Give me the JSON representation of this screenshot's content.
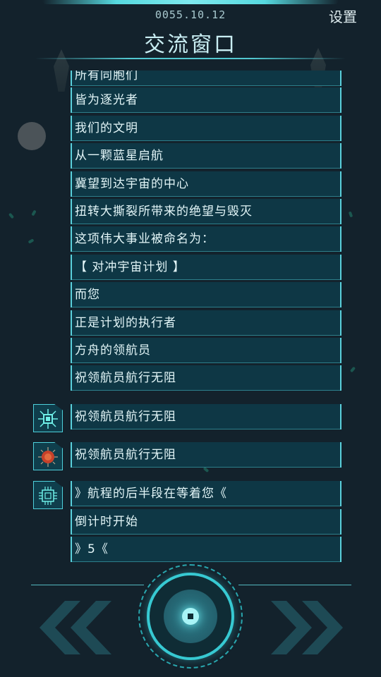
{
  "header": {
    "date": "0055.10.12",
    "settings_label": "设置",
    "title": "交流窗口"
  },
  "messages": [
    "所有同胞们",
    "皆为逐光者",
    "我们的文明",
    "从一颗蓝星启航",
    "冀望到达宇宙的中心",
    "扭转大撕裂所带来的绝望与毁灭",
    "这项伟大事业被命名为：",
    "【 对冲宇宙计划 】",
    "而您",
    "正是计划的执行者",
    "方舟的领航员",
    "祝领航员航行无阻"
  ],
  "replies": [
    {
      "icon": "chip-signal-icon",
      "text": "祝领航员航行无阻"
    },
    {
      "icon": "red-core-icon",
      "text": "祝领航员航行无阻"
    }
  ],
  "final_block": {
    "icon": "cpu-chip-icon",
    "lines": [
      "》航程的后半段在等着您《",
      "倒计时开始",
      "》5《"
    ]
  },
  "controls": {
    "prev_icon": "double-chevron-left-icon",
    "next_icon": "double-chevron-right-icon",
    "center_icon": "core-button-icon"
  },
  "colors": {
    "background": "#13222c",
    "accent": "#5ad0dc",
    "message_bg": "#0e3745"
  }
}
